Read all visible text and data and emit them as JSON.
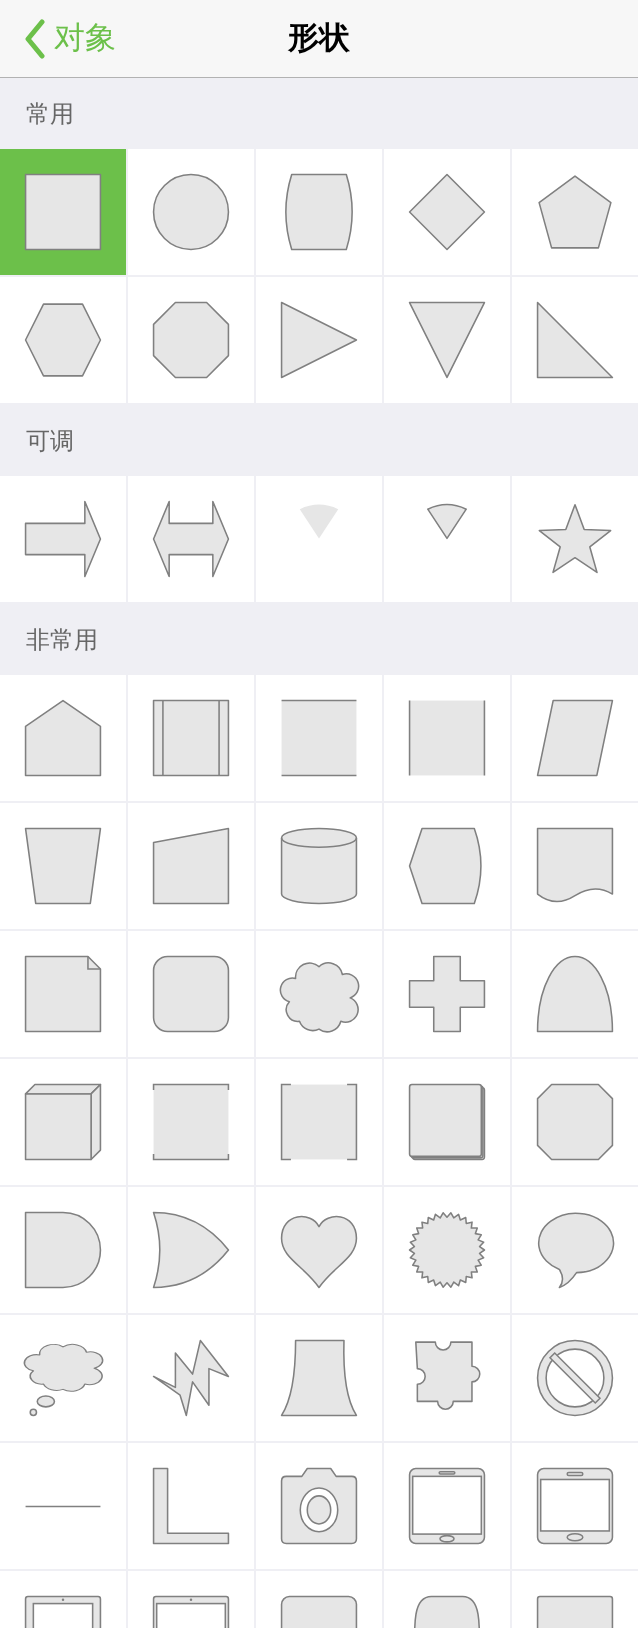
{
  "nav": {
    "back": "对象",
    "title": "形状"
  },
  "sections": [
    {
      "title": "常用",
      "shapes": [
        {
          "kind": "square",
          "selected": true
        },
        {
          "kind": "circle",
          "selected": false
        },
        {
          "kind": "barrel",
          "selected": false
        },
        {
          "kind": "diamond",
          "selected": false
        },
        {
          "kind": "pentagon",
          "selected": false
        },
        {
          "kind": "hexagon",
          "selected": false
        },
        {
          "kind": "octagon",
          "selected": false
        },
        {
          "kind": "triangle-right",
          "selected": false
        },
        {
          "kind": "triangle-down",
          "selected": false
        },
        {
          "kind": "right-triangle",
          "selected": false
        }
      ]
    },
    {
      "title": "可调",
      "shapes": [
        {
          "kind": "arrow",
          "selected": false
        },
        {
          "kind": "double-arrow",
          "selected": false
        },
        {
          "kind": "wedge-plain",
          "selected": false
        },
        {
          "kind": "wedge",
          "selected": false
        },
        {
          "kind": "star",
          "selected": false
        }
      ]
    },
    {
      "title": "非常用",
      "shapes": [
        {
          "kind": "house",
          "selected": false
        },
        {
          "kind": "process",
          "selected": false
        },
        {
          "kind": "square-top-bottom",
          "selected": false
        },
        {
          "kind": "square-sides",
          "selected": false
        },
        {
          "kind": "parallelogram",
          "selected": false
        },
        {
          "kind": "trapezoid",
          "selected": false
        },
        {
          "kind": "slanted-top",
          "selected": false
        },
        {
          "kind": "cylinder",
          "selected": false
        },
        {
          "kind": "display",
          "selected": false
        },
        {
          "kind": "document",
          "selected": false
        },
        {
          "kind": "folded-page",
          "selected": false
        },
        {
          "kind": "rounded-square",
          "selected": false
        },
        {
          "kind": "cloud",
          "selected": false
        },
        {
          "kind": "cross",
          "selected": false
        },
        {
          "kind": "arch",
          "selected": false
        },
        {
          "kind": "cube",
          "selected": false
        },
        {
          "kind": "bracket-square",
          "selected": false
        },
        {
          "kind": "corner-square",
          "selected": false
        },
        {
          "kind": "stacked-squares",
          "selected": false
        },
        {
          "kind": "octagon-wide",
          "selected": false
        },
        {
          "kind": "delay",
          "selected": false
        },
        {
          "kind": "or-gate",
          "selected": false
        },
        {
          "kind": "heart",
          "selected": false
        },
        {
          "kind": "seal",
          "selected": false
        },
        {
          "kind": "speech-bubble",
          "selected": false
        },
        {
          "kind": "thought-bubble",
          "selected": false
        },
        {
          "kind": "lightning",
          "selected": false
        },
        {
          "kind": "flare",
          "selected": false
        },
        {
          "kind": "puzzle",
          "selected": false
        },
        {
          "kind": "no-sign",
          "selected": false
        },
        {
          "kind": "line",
          "selected": false
        },
        {
          "kind": "l-shape",
          "selected": false
        },
        {
          "kind": "camera",
          "selected": false
        },
        {
          "kind": "tablet",
          "selected": false
        },
        {
          "kind": "phone",
          "selected": false
        },
        {
          "kind": "monitor",
          "selected": false
        },
        {
          "kind": "laptop",
          "selected": false
        },
        {
          "kind": "rounded-top",
          "selected": false
        },
        {
          "kind": "dome",
          "selected": false
        },
        {
          "kind": "rectangle",
          "selected": false
        }
      ]
    }
  ]
}
